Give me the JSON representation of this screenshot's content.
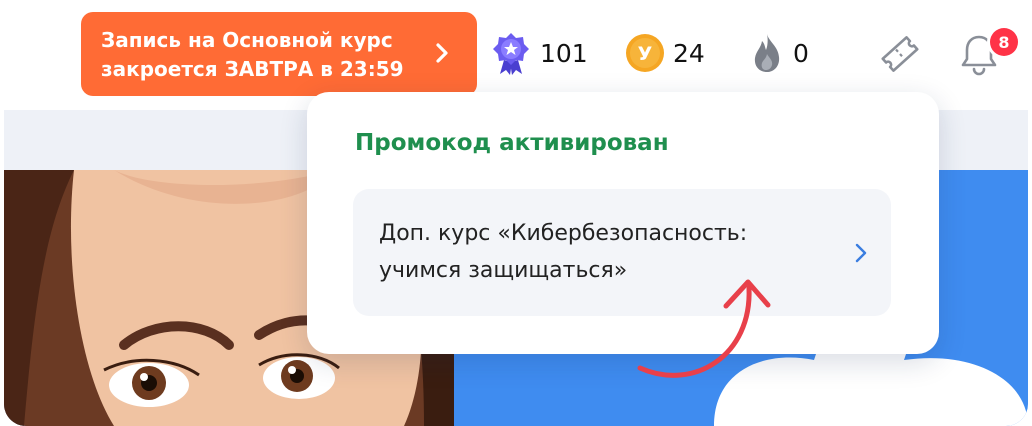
{
  "header": {
    "deadline_banner": {
      "line1": "Запись на Основной курс",
      "line2": "закроется ЗАВТРА в 23:59"
    },
    "stats": {
      "points": "101",
      "coins": "24",
      "coin_letter": "У",
      "streak": "0"
    },
    "notifications_count": "8"
  },
  "popup": {
    "title": "Промокод активирован",
    "item_line1": "Доп. курс «Кибербезопасность:",
    "item_line2": "учимся защищаться»"
  },
  "icons": [
    "medal-icon",
    "coin-icon",
    "fire-icon",
    "ticket-icon",
    "bell-icon",
    "chevron-right-icon",
    "curved-arrow-icon"
  ],
  "colors": {
    "deadline_bg": "#ff6b35",
    "title_green": "#1f8f4e",
    "banner_blue": "#3f8cf0",
    "badge_red": "#ff3347",
    "arrow_red": "#e8404a",
    "coin_orange": "#f5a623",
    "medal_purple": "#6b5cf0"
  }
}
